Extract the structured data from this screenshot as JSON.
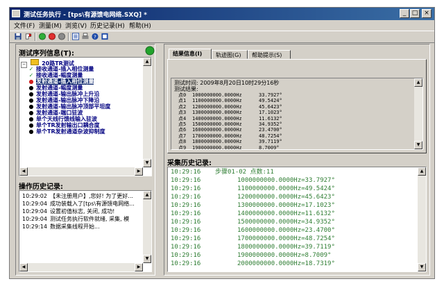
{
  "window": {
    "title": "测试任务执行 - [tps\\有源馈电网络.SXQ] *"
  },
  "title_buttons": [
    "_",
    "□",
    "×"
  ],
  "menu": [
    "文件(F)",
    "测量(M)",
    "浏览(V)",
    "历史记录(H)",
    "帮助(H)"
  ],
  "toolbar": {
    "buttons": [
      "save-icon",
      "run-icon",
      "green-circle-icon",
      "red-circle-icon",
      "gray-circle-icon",
      "list-icon",
      "print-icon",
      "help-icon",
      "info-icon"
    ],
    "colors": {
      "green": "#2fae3a",
      "red": "#e03030",
      "gray": "#8a8a8a",
      "blue": "#1d4aa8"
    }
  },
  "left": {
    "seq_label": "测试序列信息(T):",
    "status_color": "#22a32c",
    "tree": {
      "root": "20路TR测试",
      "items": [
        {
          "label": "接收通道-插入相位测量",
          "icon": "check"
        },
        {
          "label": "接收通道-幅度测量",
          "icon": "check"
        },
        {
          "label": "发射通道-插入相位测量",
          "icon": "dot-red",
          "selected": true
        },
        {
          "label": "发射通道-幅度测量",
          "icon": "dot"
        },
        {
          "label": "发射通道-输出脉冲上升沿",
          "icon": "dot"
        },
        {
          "label": "发射通道-输出脉冲下降沿",
          "icon": "dot"
        },
        {
          "label": "发射通道-输出脉冲顶部平坦度",
          "icon": "dot"
        },
        {
          "label": "发射通道-端口驻波",
          "icon": "dot"
        },
        {
          "label": "单个天线行馈线输入驻波",
          "icon": "dot"
        },
        {
          "label": "单个TR发射输出口耦合度",
          "icon": "dot"
        },
        {
          "label": "单个TR发射通道杂波抑制度",
          "icon": "dot"
        }
      ]
    },
    "history_label": "操作历史记录:",
    "history": [
      {
        "time": "10:29:02",
        "text": "【未注册用户】,您好! 为了更好..."
      },
      {
        "time": "10:29:04",
        "text": "成功装载入了[tps\\有源馈电网络..."
      },
      {
        "time": "10:29:04",
        "text": "设置初值标志, 关闭, 成功!"
      },
      {
        "time": "10:29:04",
        "text": "测试任务执行软件就绪, 采集, 模"
      },
      {
        "time": "10:29:14",
        "text": "数据采集线程开始..."
      }
    ]
  },
  "right": {
    "tabs": [
      "结果信息(I)",
      "轨迹图(G)",
      "帮助提示(S)"
    ],
    "result": {
      "time_line": "测试时间: 2009年8月20日10时29分16秒",
      "result_label": "测试结果:",
      "points": [
        {
          "name": "点0",
          "freq": "1000000000.0000Hz",
          "value": "33.7927°"
        },
        {
          "name": "点1",
          "freq": "1100000000.0000Hz",
          "value": "49.5424°"
        },
        {
          "name": "点2",
          "freq": "1200000000.0000Hz",
          "value": "45.6423°"
        },
        {
          "name": "点3",
          "freq": "1300000000.0000Hz",
          "value": "17.1023°"
        },
        {
          "name": "点4",
          "freq": "1400000000.0000Hz",
          "value": "11.6132°"
        },
        {
          "name": "点5",
          "freq": "1500000000.0000Hz",
          "value": "34.9352°"
        },
        {
          "name": "点6",
          "freq": "1600000000.0000Hz",
          "value": "23.4700°"
        },
        {
          "name": "点7",
          "freq": "1700000000.0000Hz",
          "value": "48.7254°"
        },
        {
          "name": "点8",
          "freq": "1800000000.0000Hz",
          "value": "39.7119°"
        },
        {
          "name": "点9",
          "freq": "1900000000.0000Hz",
          "value": "8.7009°"
        }
      ]
    },
    "collect_label": "采集历史记录:",
    "collect_header": {
      "time": "10:29:16",
      "text": "步骤01-02 点数:11"
    },
    "collect_rows": [
      {
        "time": "10:29:16",
        "text": "1000000000.0000Hz=33.7927°"
      },
      {
        "time": "10:29:16",
        "text": "1100000000.0000Hz=49.5424°"
      },
      {
        "time": "10:29:16",
        "text": "1200000000.0000Hz=45.6423°"
      },
      {
        "time": "10:29:16",
        "text": "1300000000.0000Hz=17.1023°"
      },
      {
        "time": "10:29:16",
        "text": "1400000000.0000Hz=11.6132°"
      },
      {
        "time": "10:29:16",
        "text": "1500000000.0000Hz=34.9352°"
      },
      {
        "time": "10:29:16",
        "text": "1600000000.0000Hz=23.4700°"
      },
      {
        "time": "10:29:16",
        "text": "1700000000.0000Hz=48.7254°"
      },
      {
        "time": "10:29:16",
        "text": "1800000000.0000Hz=39.7119°"
      },
      {
        "time": "10:29:16",
        "text": "1900000000.0000Hz=8.7009°"
      },
      {
        "time": "10:29:16",
        "text": "2000000000.0000Hz=18.7319°"
      }
    ]
  }
}
